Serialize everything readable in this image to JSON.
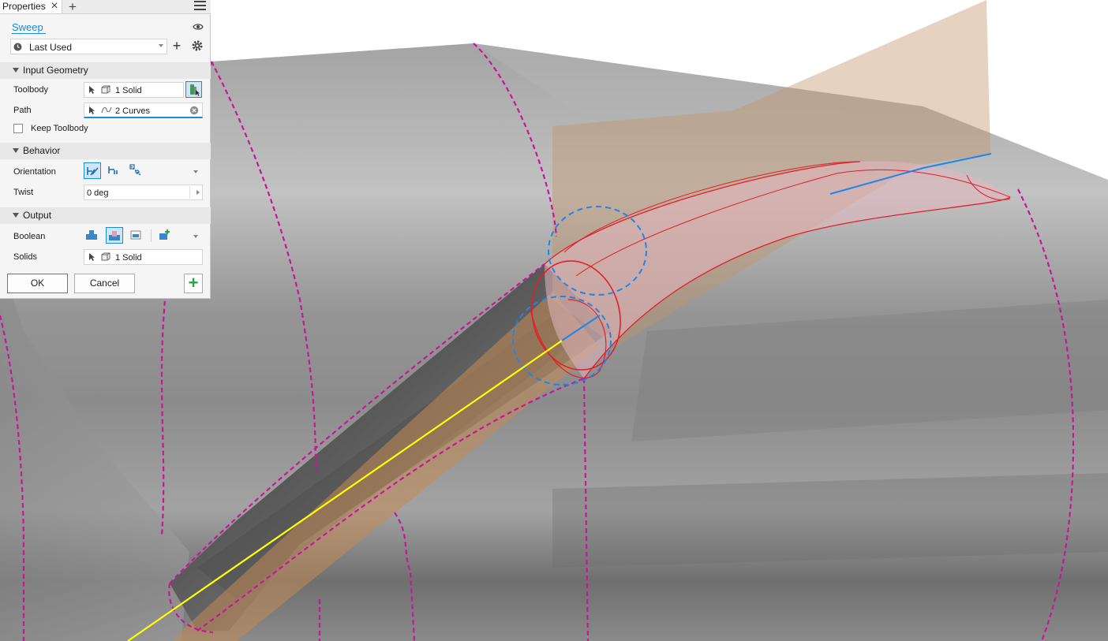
{
  "tab": {
    "label": "Properties"
  },
  "command": {
    "title": "Sweep"
  },
  "preset": {
    "value": "Last Used"
  },
  "sections": {
    "input_geometry": "Input Geometry",
    "behavior": "Behavior",
    "output": "Output"
  },
  "input_geometry": {
    "toolbody_label": "Toolbody",
    "toolbody_value": "1 Solid",
    "path_label": "Path",
    "path_value": "2 Curves",
    "keep_toolbody_label": "Keep Toolbody",
    "keep_toolbody_checked": false
  },
  "behavior": {
    "orientation_label": "Orientation",
    "orientation_selected": "path",
    "twist_label": "Twist",
    "twist_value": "0 deg"
  },
  "output": {
    "boolean_label": "Boolean",
    "boolean_selected": "cut",
    "solids_label": "Solids",
    "solids_value": "1 Solid"
  },
  "buttons": {
    "ok": "OK",
    "cancel": "Cancel"
  },
  "colors": {
    "accent": "#1a8bd6",
    "path_highlight": "#ffff00",
    "edge_dash": "#c8169c",
    "preview_edge": "#e0202a",
    "apply": "#27a444"
  },
  "icons": [
    "close-icon",
    "plus-icon",
    "menu-icon",
    "eye-icon",
    "clock-icon",
    "gear-icon",
    "select-arrow-icon",
    "solid-cube-icon",
    "curve-icon",
    "clear-icon",
    "caret-down-icon"
  ]
}
